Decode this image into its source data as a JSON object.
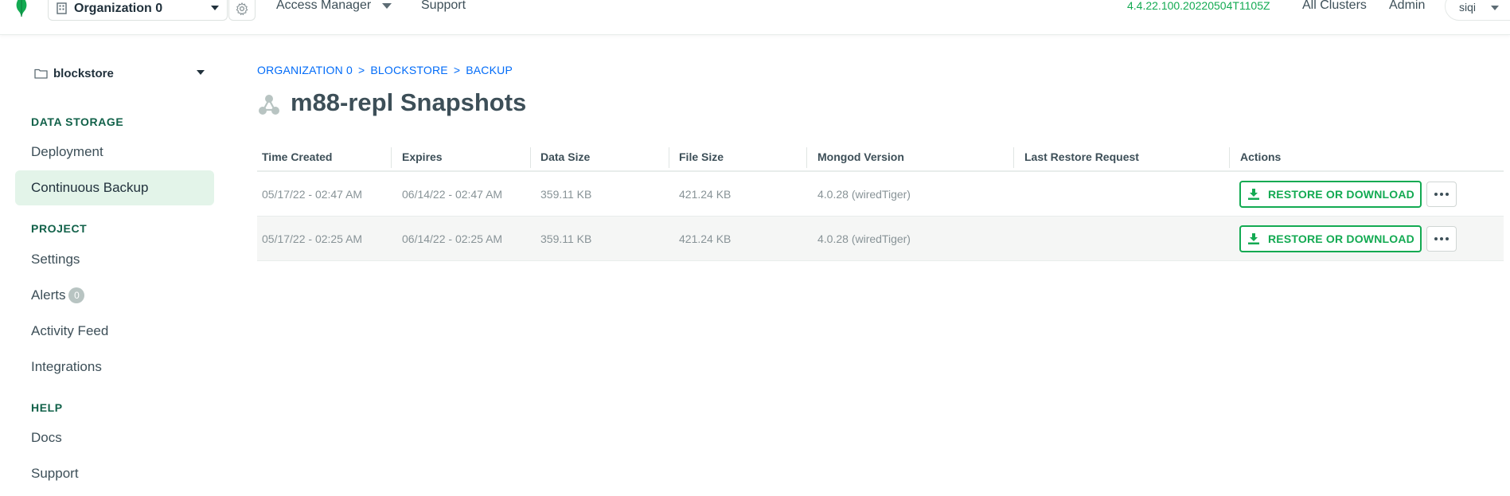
{
  "topbar": {
    "org_name": "Organization 0",
    "access_manager": "Access Manager",
    "support": "Support",
    "version": "4.4.22.100.20220504T1105Z",
    "all_clusters": "All Clusters",
    "admin": "Admin",
    "user": "siqi"
  },
  "sidebar": {
    "project_name": "blockstore",
    "sections": {
      "data_storage": "DATA STORAGE",
      "project": "PROJECT",
      "help": "HELP"
    },
    "items": {
      "deployment": "Deployment",
      "continuous_backup": "Continuous Backup",
      "settings": "Settings",
      "alerts": "Alerts",
      "alerts_count": "0",
      "activity_feed": "Activity Feed",
      "integrations": "Integrations",
      "docs": "Docs",
      "support": "Support"
    }
  },
  "main": {
    "breadcrumb": [
      "ORGANIZATION 0",
      "BLOCKSTORE",
      "BACKUP"
    ],
    "breadcrumb_sep": ">",
    "title": "m88-repl Snapshots",
    "columns": [
      "Time Created",
      "Expires",
      "Data Size",
      "File Size",
      "Mongod Version",
      "Last Restore Request",
      "Actions"
    ],
    "rows": [
      {
        "time_created": "05/17/22 - 02:47 AM",
        "expires": "06/14/22 - 02:47 AM",
        "data_size": "359.11 KB",
        "file_size": "421.24 KB",
        "mongod_version": "4.0.28 (wiredTiger)",
        "last_restore": "",
        "action_label": "RESTORE OR DOWNLOAD"
      },
      {
        "time_created": "05/17/22 - 02:25 AM",
        "expires": "06/14/22 - 02:25 AM",
        "data_size": "359.11 KB",
        "file_size": "421.24 KB",
        "mongod_version": "4.0.28 (wiredTiger)",
        "last_restore": "",
        "action_label": "RESTORE OR DOWNLOAD"
      }
    ]
  },
  "colors": {
    "brand_green": "#13aa52",
    "dark_green": "#116149",
    "link_blue": "#016bf8",
    "active_bg": "#e3f4e9"
  },
  "icons": {
    "logo": "mongodb-leaf-icon",
    "org": "building-icon",
    "settings": "gear-icon",
    "project": "folder-icon",
    "replica_set": "replica-set-icon",
    "download": "download-icon",
    "more": "ellipsis-icon"
  }
}
